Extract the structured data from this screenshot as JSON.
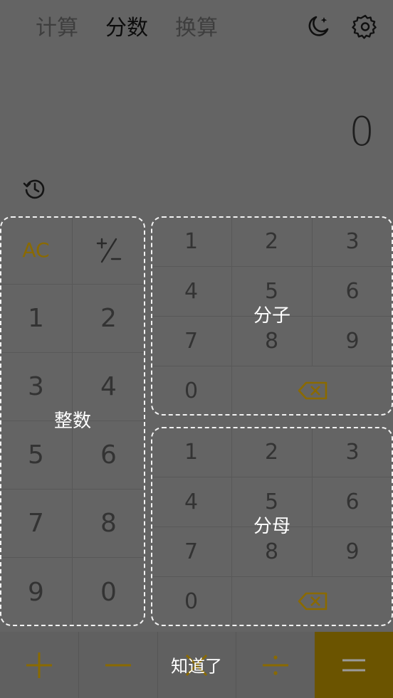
{
  "header": {
    "tabs": [
      {
        "label": "计算"
      },
      {
        "label": "分数"
      },
      {
        "label": "换算"
      }
    ],
    "active_tab": "分数"
  },
  "display": {
    "value": "0"
  },
  "integer_pad": {
    "label": "整数",
    "keys": [
      "AC",
      "±",
      "1",
      "2",
      "3",
      "4",
      "5",
      "6",
      "7",
      "8",
      "9",
      "0"
    ]
  },
  "numerator_pad": {
    "label": "分子",
    "keys": [
      "1",
      "2",
      "3",
      "4",
      "5",
      "6",
      "7",
      "8",
      "9",
      "0"
    ]
  },
  "denominator_pad": {
    "label": "分母",
    "keys": [
      "1",
      "2",
      "3",
      "4",
      "5",
      "6",
      "7",
      "8",
      "9",
      "0"
    ]
  },
  "operators": {
    "add": "+",
    "subtract": "−",
    "multiply": "×",
    "divide": "÷",
    "equals": "="
  },
  "overlay": {
    "dismiss_label": "知道了"
  },
  "colors": {
    "background": "#646464",
    "accent": "#8a6a00",
    "equals_bg": "#6b5400"
  }
}
